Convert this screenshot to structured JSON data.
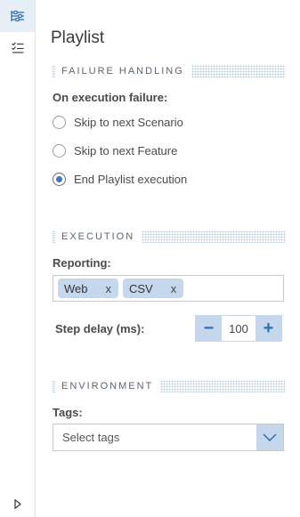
{
  "sidebar": {
    "items": [
      {
        "icon": "flow-settings-icon",
        "active": true
      },
      {
        "icon": "checklist-icon",
        "active": false
      },
      {
        "icon": "expand-arrow-icon",
        "active": false
      }
    ]
  },
  "header": {
    "title": "Playlist"
  },
  "failure_handling": {
    "section_title": "FAILURE HANDLING",
    "label": "On execution failure:",
    "options": [
      {
        "label": "Skip to next Scenario",
        "checked": false
      },
      {
        "label": "Skip to next Feature",
        "checked": false
      },
      {
        "label": "End Playlist execution",
        "checked": true
      }
    ]
  },
  "execution": {
    "section_title": "EXECUTION",
    "reporting_label": "Reporting:",
    "reporting_tags": [
      {
        "label": "Web",
        "remove": "x"
      },
      {
        "label": "CSV",
        "remove": "x"
      }
    ],
    "step_delay_label": "Step delay (ms):",
    "step_delay_value": "100",
    "decrement": "−",
    "increment": "+"
  },
  "environment": {
    "section_title": "ENVIRONMENT",
    "tags_label": "Tags:",
    "tags_placeholder": "Select tags"
  },
  "colors": {
    "accent": "#3b78c2",
    "chip_bg": "#c5d7ec",
    "active_rail": "#e6eef6"
  }
}
